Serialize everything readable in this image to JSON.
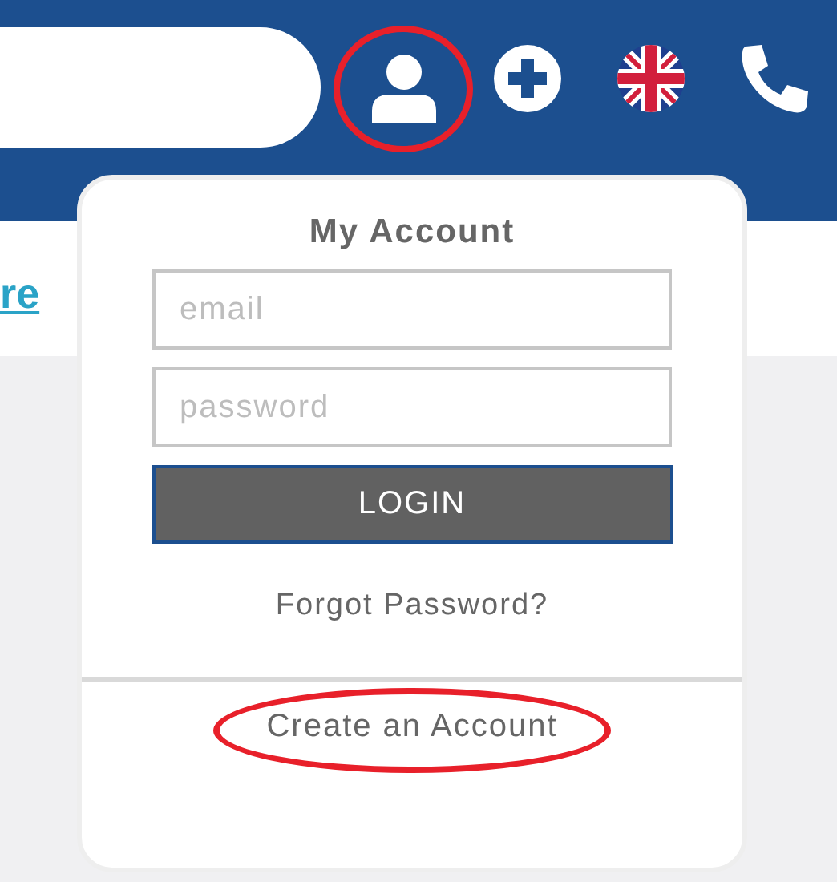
{
  "header": {
    "icons": [
      {
        "kind": "account",
        "highlighted": true
      },
      {
        "kind": "add",
        "highlighted": false
      },
      {
        "kind": "flag",
        "highlighted": false
      },
      {
        "kind": "phone",
        "highlighted": false
      }
    ]
  },
  "content": {
    "link": "re"
  },
  "account_menu": {
    "title": "My Account",
    "email": {
      "placeholder": "email"
    },
    "password": {
      "placeholder": "password"
    },
    "login_button": "LOGIN",
    "forgot_link": "Forgot Password?",
    "create_link": {
      "label": "Create an Account",
      "highlighted": true
    }
  }
}
